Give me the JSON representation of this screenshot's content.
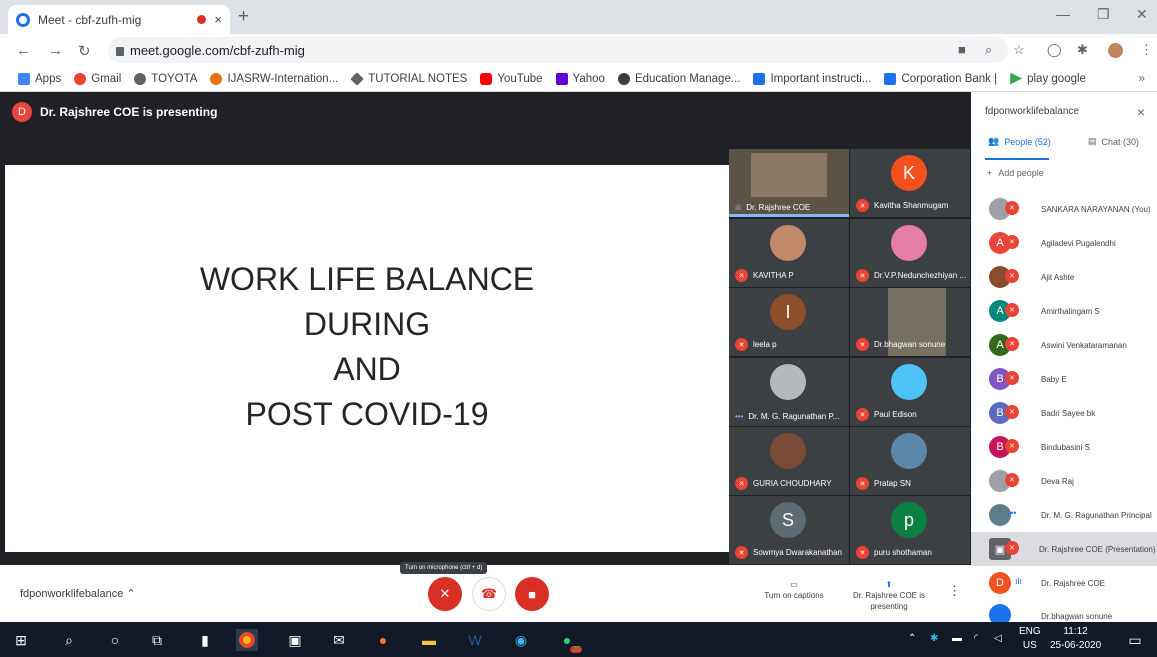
{
  "browser": {
    "tab_title": "Meet - cbf-zufh-mig",
    "tab_close": "×",
    "new_tab": "+",
    "url": "meet.google.com/cbf-zufh-mig",
    "bookmarks": [
      {
        "label": "Apps",
        "color": "#4285f4"
      },
      {
        "label": "Gmail",
        "color": "#ea4335"
      },
      {
        "label": "TOYOTA",
        "color": "#5f6368"
      },
      {
        "label": "IJASRW-Internation...",
        "color": "#e8710a"
      },
      {
        "label": "TUTORIAL NOTES",
        "color": "#5f6368"
      },
      {
        "label": "YouTube",
        "color": "#ff0000"
      },
      {
        "label": "Yahoo",
        "color": "#6001d2"
      },
      {
        "label": "Education Manage...",
        "color": "#3c4043"
      },
      {
        "label": "Important instructi...",
        "color": "#1a73e8"
      },
      {
        "label": "Corporation Bank |",
        "color": "#1a73e8"
      },
      {
        "label": "play google",
        "color": "#34a853"
      }
    ],
    "bookmarks_more": "»"
  },
  "meet": {
    "presenting_banner": "Dr. Rajshree COE is presenting",
    "presenter_initial": "D",
    "slide_lines": [
      "WORK LIFE BALANCE",
      "DURING",
      "AND",
      "POST COVID-19"
    ],
    "tiles": [
      {
        "name": "Dr. Rajshree COE",
        "type": "video",
        "muted": false
      },
      {
        "name": "Kavitha Shanmugam",
        "type": "letter",
        "initial": "K",
        "color": "#f4511e",
        "muted": true
      },
      {
        "name": "KAVITHA P",
        "type": "photo",
        "muted": true
      },
      {
        "name": "Dr.V.P.Nedunchezhiyan ...",
        "type": "photo",
        "muted": true
      },
      {
        "name": "leela p",
        "type": "letter",
        "initial": "I",
        "color": "#8d4e2c",
        "muted": true
      },
      {
        "name": "Dr.bhagwan sonune",
        "type": "video",
        "muted": true
      },
      {
        "name": "Dr. M. G. Ragunathan P...",
        "type": "photo",
        "muted": false
      },
      {
        "name": "Paul Edison",
        "type": "photo",
        "muted": true
      },
      {
        "name": "GURIA CHOUDHARY",
        "type": "photo",
        "muted": true
      },
      {
        "name": "Pratap SN",
        "type": "photo",
        "muted": true
      },
      {
        "name": "Sowmya Dwarakanathan",
        "type": "letter",
        "initial": "S",
        "color": "#5f6b73",
        "muted": true
      },
      {
        "name": "puru shothaman",
        "type": "letter",
        "initial": "p",
        "color": "#0b8043",
        "muted": true
      }
    ],
    "meeting_name": "fdponworklifebalance",
    "tooltip": "Turn on microphone (ctrl + d)",
    "captions_label": "Turn on captions",
    "presenting_label": "Dr. Rajshree COE is presenting"
  },
  "panel": {
    "title": "fdponworklifebalance",
    "close": "×",
    "people_tab": "People (52)",
    "chat_tab": "Chat (30)",
    "add_people": "Add people",
    "participants": [
      {
        "name": "SANKARA NARAYANAN (You)",
        "initial": "",
        "color": "#9aa0a6",
        "status": "muted"
      },
      {
        "name": "Agiladevi Pugalendhi",
        "initial": "A",
        "color": "#e8453c",
        "status": "muted"
      },
      {
        "name": "Ajit Ashte",
        "initial": "",
        "color": "#8a4b2e",
        "status": "muted"
      },
      {
        "name": "Amirthalingam S",
        "initial": "A",
        "color": "#00897b",
        "status": "muted"
      },
      {
        "name": "Aswini Venkataramanan",
        "initial": "A",
        "color": "#33691e",
        "status": "muted"
      },
      {
        "name": "Baby E",
        "initial": "B",
        "color": "#7e57c2",
        "status": "muted"
      },
      {
        "name": "Badri Sayee bk",
        "initial": "B",
        "color": "#5c6bc0",
        "status": "muted"
      },
      {
        "name": "Bindubasini S",
        "initial": "B",
        "color": "#c2185b",
        "status": "muted"
      },
      {
        "name": "Deva Raj",
        "initial": "",
        "color": "#9aa0a6",
        "status": "muted"
      },
      {
        "name": "Dr. M. G. Ragunathan Principal",
        "initial": "",
        "color": "#607d8b",
        "status": "more"
      },
      {
        "name": "Dr. Rajshree COE (Presentation)",
        "initial": "",
        "color": "#5f6368",
        "status": "muted"
      },
      {
        "name": "Dr. Rajshree COE",
        "initial": "D",
        "color": "#f4511e",
        "status": "speaking"
      },
      {
        "name": "Dr.bhagwan sonune",
        "initial": "",
        "color": "#1a73e8",
        "status": "muted"
      }
    ]
  },
  "taskbar": {
    "lang": "ENG",
    "region": "US",
    "time": "11:12",
    "date": "25-06-2020",
    "whatsapp_badge": "26"
  }
}
